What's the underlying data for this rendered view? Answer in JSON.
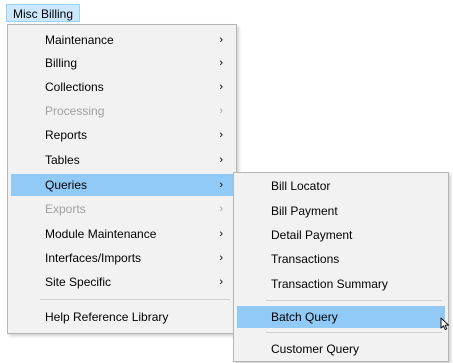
{
  "menubar": {
    "title": "Misc Billing"
  },
  "main_menu": {
    "items": [
      {
        "label": "Maintenance",
        "arrow": "›"
      },
      {
        "label": "Billing",
        "arrow": "›"
      },
      {
        "label": "Collections",
        "arrow": "›"
      },
      {
        "label": "Processing",
        "arrow": "›"
      },
      {
        "label": "Reports",
        "arrow": "›"
      },
      {
        "label": "Tables",
        "arrow": "›"
      },
      {
        "label": "Queries",
        "arrow": "›"
      },
      {
        "label": "Exports",
        "arrow": "›"
      },
      {
        "label": "Module Maintenance",
        "arrow": "›"
      },
      {
        "label": "Interfaces/Imports",
        "arrow": "›"
      },
      {
        "label": "Site Specific",
        "arrow": "›"
      },
      {
        "label": "Help Reference Library"
      }
    ]
  },
  "queries_submenu": {
    "items": [
      {
        "label": "Bill Locator"
      },
      {
        "label": "Bill Payment"
      },
      {
        "label": "Detail Payment"
      },
      {
        "label": "Transactions"
      },
      {
        "label": "Transaction Summary"
      },
      {
        "label": "Batch Query"
      },
      {
        "label": "Customer Query"
      }
    ]
  },
  "colors": {
    "menu_background": "#f2f2f2",
    "highlight": "#91c9f7",
    "menubar_highlight": "#cce8ff",
    "disabled_text": "#a0a0a0"
  }
}
